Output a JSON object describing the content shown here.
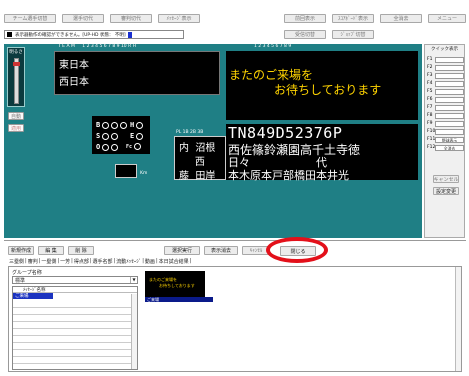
{
  "toolbar": {
    "buttons": [
      "チーム選手切替",
      "選手切代",
      "審判切代",
      "ﾒｯｾｰｼﾞ表示",
      "前回表示",
      "ｽｺｱﾎﾞｰﾄﾞ表示",
      "全消去",
      "メニュー"
    ],
    "status_text": "表示器動作の確認ができません。[UP-HD 状態：  不明]",
    "right_buttons": [
      "受信切替",
      "ｼﾞｮｯﾌﾞ切替"
    ]
  },
  "panel": {
    "brightness_label": "明るさ",
    "auto_label": "自動",
    "apply_label": "適用",
    "team_header": "T E A M",
    "team_header_digits": "1  2  3  4  5  6  7  8  9  10  R  H",
    "teams": [
      "東日本",
      "西日本"
    ],
    "bso": [
      {
        "k": "B",
        "n": 3
      },
      {
        "k": "S",
        "n": 2
      },
      {
        "k": "O",
        "n": 2
      }
    ],
    "he": [
      {
        "k": "H"
      },
      {
        "k": "E"
      },
      {
        "k": "Fc"
      }
    ],
    "km_label": "Km",
    "umpire_header": "PL  1B  2B  3B",
    "umpires": [
      [
        "内",
        "沼根"
      ],
      [
        "",
        "西"
      ],
      [
        "藤",
        "田岸"
      ]
    ],
    "message_line1": "またのご来場を",
    "message_line2": "お待ちしております",
    "digits_header": "1  2  3  4  5  6  7  8  9",
    "lineup_row1": "TN849D52376P",
    "lineup_row2": "西佐篠鈴瀬園高千土寺徳",
    "lineup_row3": "日々　　　　　　代",
    "lineup_row4": "本木原本戸部橋田本井光"
  },
  "quick": {
    "title": "クイック表示",
    "keys": [
      "F1",
      "F2",
      "F3",
      "F4",
      "F5",
      "F6",
      "F7",
      "F8",
      "F9",
      "F10",
      "F11",
      "F12"
    ],
    "values": [
      "",
      "",
      "",
      "",
      "",
      "",
      "",
      "",
      "",
      "",
      "野球表示",
      "全消去"
    ],
    "buttons": [
      "キャンセル",
      "設定変更"
    ]
  },
  "lower": {
    "buttons": [
      "新規作成",
      "編 集",
      "削 除",
      "選択実行",
      "表示消去",
      "ｷｬﾝｾﾙ",
      "閉じる"
    ],
    "tabs": [
      "三塁側",
      "審判",
      "一塁側",
      "一芳",
      "得点部",
      "選手名部",
      "流動ﾒｯｾｰｼﾞ",
      "動画",
      "本日試合結果"
    ],
    "group_label": "グループ名称",
    "group_value": "標準",
    "list_header": "ﾒｯｾｰｼﾞ名称",
    "list_items": [
      "ご来場"
    ],
    "preview_line1": "またのご来場を",
    "preview_line2": "お待ちしております",
    "preview_caption": "ご来場"
  },
  "colors": {
    "panel": "#1f7f85",
    "message": "#ffd400",
    "highlight_circle": "#e3101a",
    "selection": "#0a1a8a"
  }
}
